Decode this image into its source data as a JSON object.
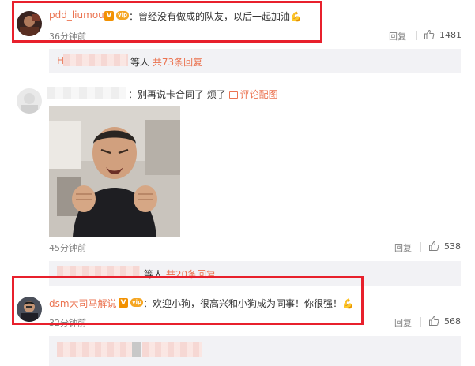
{
  "comments": [
    {
      "username": "pdd_liumou",
      "verified_badge": "V",
      "vip_badge": "vip",
      "text": "：曾经没有做成的队友，以后一起加油",
      "emoji": "💪",
      "time": "36分钟前",
      "reply_label": "回复",
      "likes": "1481"
    },
    {
      "username": "",
      "text": "：别再说卡合同了 烦了",
      "pic_link": "评论配图",
      "time": "45分钟前",
      "reply_label": "回复",
      "likes": "538"
    },
    {
      "username": "dsm大司马解说",
      "verified_badge": "V",
      "vip_badge": "vip",
      "text": "：欢迎小狗，很高兴和小狗成为同事！你很强！",
      "emoji": "💪",
      "time": "32分钟前",
      "reply_label": "回复",
      "likes": "568"
    }
  ],
  "subreplies": [
    {
      "prefix": "H",
      "suffix": "等人",
      "count_link": "共73条回复"
    },
    {
      "suffix": "等人",
      "count_link": "共20条回复"
    }
  ],
  "colors": {
    "username": "#eb7350",
    "highlight_border": "#e8202c",
    "subreply_bg": "#f2f2f5",
    "meta_text": "#808080"
  },
  "icons": [
    "verified-v-icon",
    "vip-badge-icon",
    "thumbs-up-icon",
    "picture-icon",
    "flexed-biceps-emoji"
  ]
}
